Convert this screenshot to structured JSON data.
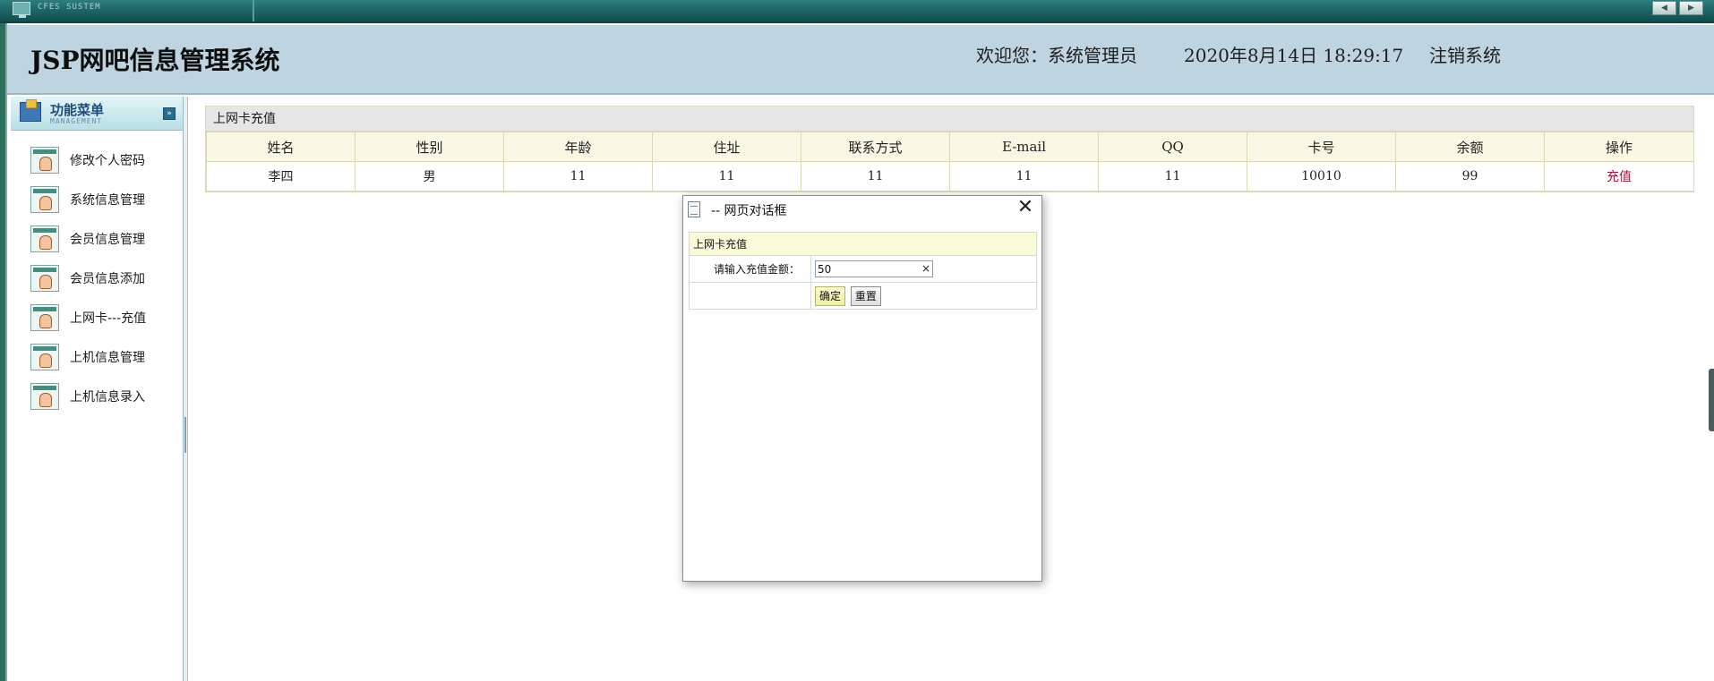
{
  "topbar": {
    "system_name": "CFES SUSTEM",
    "nav_prev": "◀",
    "nav_next": "▶"
  },
  "header": {
    "app_title": "JSP网吧信息管理系统",
    "welcome": "欢迎您：系统管理员",
    "datetime": "2020年8月14日  18:29:17",
    "logout": "注销系统"
  },
  "sidebar": {
    "menu_title": "功能菜单",
    "menu_subtitle": "MANAGEMENT",
    "toggle": "»",
    "items": [
      {
        "label": "修改个人密码"
      },
      {
        "label": "系统信息管理"
      },
      {
        "label": "会员信息管理"
      },
      {
        "label": "会员信息添加"
      },
      {
        "label": "上网卡---充值"
      },
      {
        "label": "上机信息管理"
      },
      {
        "label": "上机信息录入"
      }
    ]
  },
  "panel": {
    "title": "上网卡充值",
    "columns": [
      "姓名",
      "性别",
      "年龄",
      "住址",
      "联系方式",
      "E-mail",
      "QQ",
      "卡号",
      "余额",
      "操作"
    ],
    "rows": [
      {
        "name": "李四",
        "gender": "男",
        "age": "11",
        "address": "11",
        "contact": "11",
        "email": "11",
        "qq": "11",
        "card_no": "10010",
        "balance": "99",
        "action": "充值"
      }
    ]
  },
  "dialog": {
    "title": "-- 网页对话框",
    "close": "✕",
    "form_title": "上网卡充值",
    "amount_label": "请输入充值金额：",
    "amount_value": "50",
    "clear": "×",
    "confirm": "确定",
    "reset": "重置"
  }
}
